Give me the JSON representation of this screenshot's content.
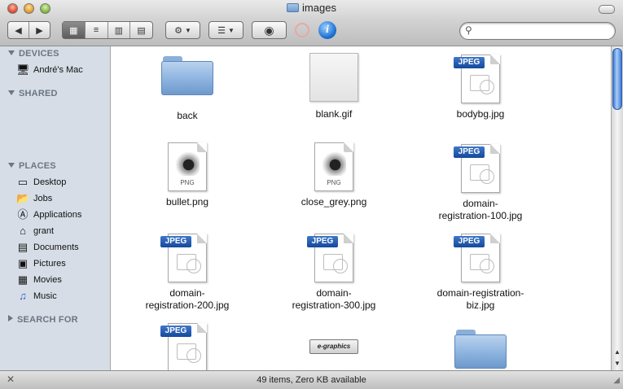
{
  "window": {
    "title": "images"
  },
  "toolbar": {
    "back_icon": "arrow-left-icon",
    "forward_icon": "arrow-right-icon",
    "views": [
      "icon-view",
      "list-view",
      "column-view",
      "coverflow-view"
    ],
    "selected_view": "icon-view",
    "search_placeholder": ""
  },
  "sidebar": {
    "devices": {
      "title": "DEVICES",
      "items": [
        {
          "label": "André's Mac",
          "icon": "computer-icon"
        }
      ]
    },
    "shared": {
      "title": "SHARED"
    },
    "places": {
      "title": "PLACES",
      "items": [
        {
          "label": "Desktop",
          "icon": "desktop-icon"
        },
        {
          "label": "Jobs",
          "icon": "jobs-folder-icon"
        },
        {
          "label": "Applications",
          "icon": "applications-icon"
        },
        {
          "label": "grant",
          "icon": "home-icon"
        },
        {
          "label": "Documents",
          "icon": "documents-icon"
        },
        {
          "label": "Pictures",
          "icon": "pictures-icon"
        },
        {
          "label": "Movies",
          "icon": "movies-icon"
        },
        {
          "label": "Music",
          "icon": "music-icon"
        }
      ]
    },
    "search_for": {
      "title": "SEARCH FOR"
    }
  },
  "files": [
    {
      "name": "back",
      "type": "folder"
    },
    {
      "name": "blank.gif",
      "type": "gif"
    },
    {
      "name": "bodybg.jpg",
      "type": "jpeg",
      "badge": "JPEG"
    },
    {
      "name": "bullet.png",
      "type": "png",
      "badge": "PNG"
    },
    {
      "name": "close_grey.png",
      "type": "png",
      "badge": "PNG"
    },
    {
      "name": "domain-registration-100.jpg",
      "label_line1": "domain-",
      "label_line2": "registration-100.jpg",
      "type": "jpeg",
      "badge": "JPEG"
    },
    {
      "name": "domain-registration-200.jpg",
      "label_line1": "domain-",
      "label_line2": "registration-200.jpg",
      "type": "jpeg",
      "badge": "JPEG"
    },
    {
      "name": "domain-registration-300.jpg",
      "label_line1": "domain-",
      "label_line2": "registration-300.jpg",
      "type": "jpeg",
      "badge": "JPEG"
    },
    {
      "name": "domain-registration-biz.jpg",
      "label_line1": "domain-registration-",
      "label_line2": "biz.jpg",
      "type": "jpeg",
      "badge": "JPEG"
    },
    {
      "name": "",
      "type": "jpeg",
      "badge": "JPEG"
    },
    {
      "name": "",
      "type": "logo-image",
      "badge": "e-graphics"
    },
    {
      "name": "",
      "type": "folder"
    }
  ],
  "status": {
    "text": "49 items, Zero KB available"
  }
}
